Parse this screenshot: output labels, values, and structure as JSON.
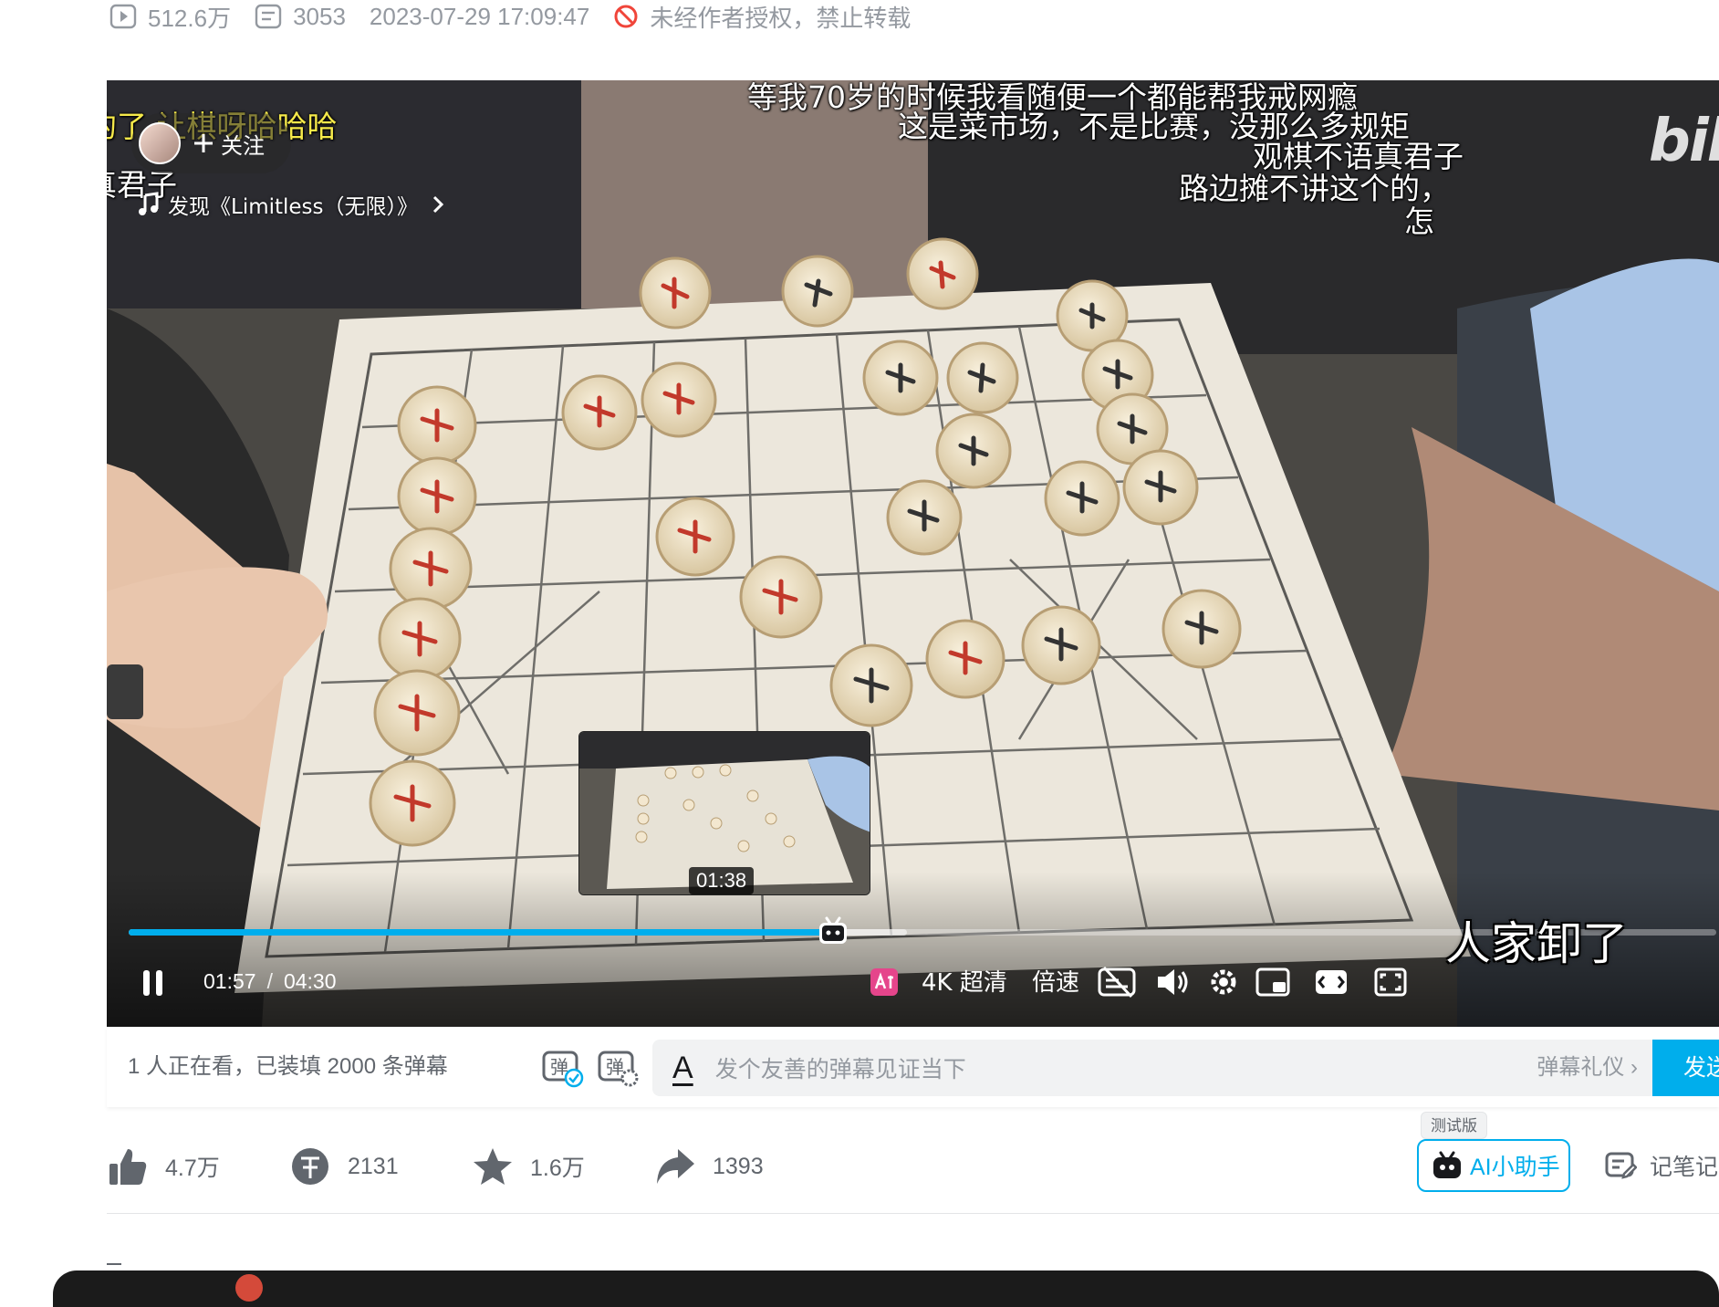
{
  "stats": {
    "views": "512.6万",
    "danmaku_count": "3053",
    "publish_time": "2023-07-29 17:09:47",
    "copyright_notice": "未经作者授权，禁止转载"
  },
  "video": {
    "follow_label": "关注",
    "music": "发现《Limitless（无限）》",
    "logo_text": "bili",
    "danmaku": [
      {
        "text": "等我70岁的时候我看随便一个都能帮我戒网瘾"
      },
      {
        "text": "这是菜市场，不是比赛，没那么多规矩"
      },
      {
        "text": "观棋不语真君子"
      },
      {
        "text": "路边摊不讲这个的，"
      },
      {
        "text": "怎"
      },
      {
        "text": "的了 让棋呀哈哈哈"
      },
      {
        "text": "真君子"
      }
    ],
    "preview_time": "01:38",
    "current_time": "01:57",
    "time_separator": "/",
    "duration": "04:30",
    "progress": 0.437,
    "buffered": 0.49,
    "quality": "4K 超清",
    "speed_label": "倍速",
    "caption": "人家卸了",
    "accent_color": "#00aeec"
  },
  "danmaku_bar": {
    "watching_text": "1 人正在看，已装填 2000 条弹幕",
    "input_placeholder": "发个友善的弹幕见证当下",
    "etiquette_label": "弹幕礼仪 ›",
    "send_label": "发送"
  },
  "toolbar": {
    "like_count": "4.7万",
    "coin_count": "2131",
    "favorite_count": "1.6万",
    "share_count": "1393",
    "ai_beta_tag": "测试版",
    "ai_label": "AI小助手",
    "notes_label": "记笔记"
  }
}
